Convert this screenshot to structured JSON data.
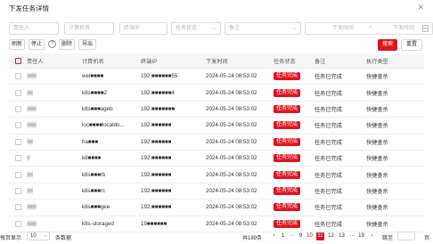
{
  "dialog": {
    "title": "下发任务详情",
    "close_icon": "close-icon"
  },
  "filters": {
    "owner_placeholder": "责任人",
    "hostname_placeholder": "计算机名",
    "ip_placeholder": "终端IP",
    "status_placeholder": "任务状态",
    "remark_placeholder": "备注",
    "start_placeholder": "下发时间",
    "end_placeholder": "下发时间",
    "range_sep": "~"
  },
  "toolbar": {
    "refresh": "刷新",
    "stop": "停止",
    "delete": "删除",
    "export": "导出",
    "search": "搜索",
    "reset": "重置"
  },
  "table": {
    "headers": [
      "责任人",
      "计算机名",
      "终端IP",
      "下发时间",
      "任务状态",
      "备注",
      "执行类型"
    ],
    "rows": [
      {
        "owner": "■■■",
        "host": "wei■■■■",
        "ip": "192.■■■■■■55",
        "time": "2024-05-24 08:53:02",
        "status": "任务完成",
        "remark": "任务已完成",
        "type": "快捷查杀"
      },
      {
        "owner": "■■",
        "host": "k8s■■■■2",
        "ip": "192.■■■■■■4",
        "time": "2024-05-24 08:53:02",
        "status": "任务完成",
        "remark": "任务已完成",
        "type": "快捷查杀"
      },
      {
        "owner": "■■■",
        "host": "k8s■■■ageb",
        "ip": "192.■■■■■■■",
        "time": "2024-05-24 08:53:02",
        "status": "任务完成",
        "remark": "任务已完成",
        "type": "快捷查杀"
      },
      {
        "owner": "■■■",
        "host": "loc■■■■localdo...",
        "ip": "192.■■■■■■",
        "time": "2024-05-24 08:53:02",
        "status": "任务完成",
        "remark": "任务已完成",
        "type": "快捷查杀"
      },
      {
        "owner": "■■",
        "host": "ha■■■",
        "ip": "192.■■■■■■",
        "time": "2024-05-24 08:53:02",
        "status": "任务完成",
        "remark": "任务已完成",
        "type": "快捷查杀"
      },
      {
        "owner": "■",
        "host": "k8■■■■",
        "ip": "192.■■■■■■",
        "time": "2024-05-24 08:53:02",
        "status": "任务完成",
        "remark": "任务已完成",
        "type": "快捷查杀"
      },
      {
        "owner": "■■",
        "host": "k8s■■■rb",
        "ip": "192.■■■■■■",
        "time": "2024-05-24 08:53:02",
        "status": "任务完成",
        "remark": "任务已完成",
        "type": "快捷查杀"
      },
      {
        "owner": "■■",
        "host": "k8s■■■rc",
        "ip": "192.■■■■■■",
        "time": "2024-05-24 08:53:02",
        "status": "任务完成",
        "remark": "任务已完成",
        "type": "快捷查杀"
      },
      {
        "owner": "■■■",
        "host": "k8s■■■gee",
        "ip": "192.■■■■■■",
        "time": "2024-05-24 08:53:02",
        "status": "任务完成",
        "remark": "任务已完成",
        "type": "快捷查杀"
      },
      {
        "owner": "■■■",
        "host": "k8s-storaged",
        "ip": "19■■■■■■",
        "time": "2024-05-24 08:53:02",
        "status": "任务完成",
        "remark": "任务已完成",
        "type": "快捷查杀"
      }
    ]
  },
  "footer": {
    "per_page_label": "每页显示",
    "per_page_value": "10",
    "per_page_suffix": "条数据",
    "total": "共189条",
    "pages": [
      "‹",
      "1",
      "···",
      "9",
      "10",
      "11",
      "12",
      "13",
      "···",
      "19",
      "›"
    ],
    "active_page": "11",
    "goto_label": "跳至",
    "goto_suffix": "页"
  },
  "colors": {
    "accent": "#e0141e"
  }
}
